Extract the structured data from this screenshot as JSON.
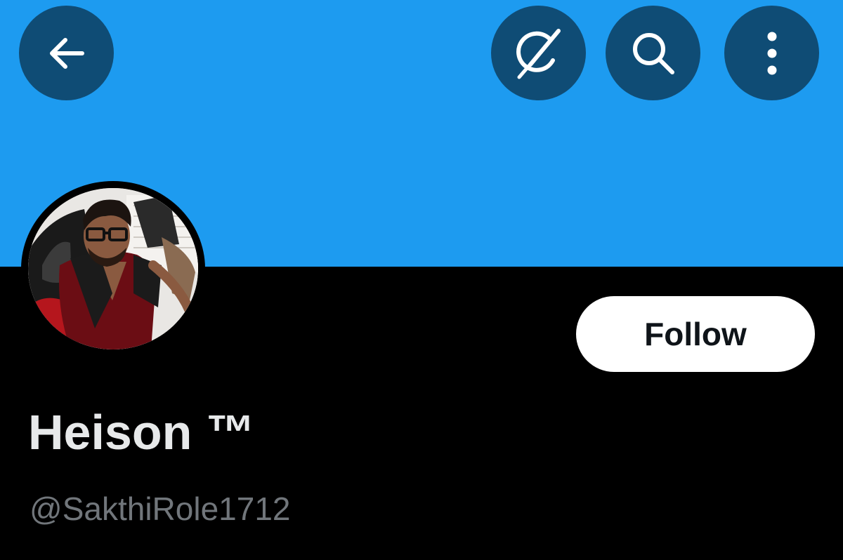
{
  "header": {
    "back_icon": "arrow-left-icon",
    "grok_icon": "grok-icon",
    "search_icon": "search-icon",
    "more_icon": "more-vertical-icon"
  },
  "profile": {
    "display_name": "Heison ™",
    "handle": "@SakthiRole1712",
    "follow_label": "Follow"
  },
  "colors": {
    "banner": "#1d9bf0",
    "icon_button_bg": "#0f4c75",
    "page_bg": "#000000",
    "name_text": "#e7e9ea",
    "handle_text": "#71767b",
    "follow_bg": "#ffffff",
    "follow_text": "#0f1419"
  }
}
